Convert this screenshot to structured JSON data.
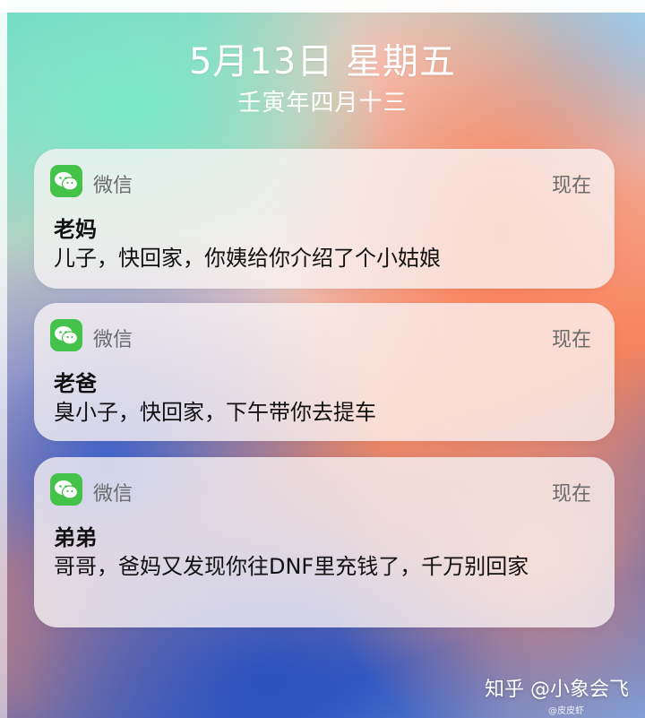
{
  "lockscreen": {
    "date": "5月13日 星期五",
    "lunar_date": "壬寅年四月十三"
  },
  "notifications": [
    {
      "app": "微信",
      "time": "现在",
      "sender": "老妈",
      "message": "儿子，快回家，你姨给你介绍了个小姑娘",
      "icon": "wechat-icon"
    },
    {
      "app": "微信",
      "time": "现在",
      "sender": "老爸",
      "message": "臭小子，快回家，下午带你去提车",
      "icon": "wechat-icon"
    },
    {
      "app": "微信",
      "time": "现在",
      "sender": "弟弟",
      "message": "哥哥，爸妈又发现你往DNF里充钱了，千万别回家",
      "icon": "wechat-icon"
    }
  ],
  "watermark": {
    "main": "知乎 @小象会飞",
    "small": "@皮皮虾"
  },
  "colors": {
    "wechat_green": "#45c24a",
    "card_bg": "rgba(250,245,245,0.78)"
  }
}
